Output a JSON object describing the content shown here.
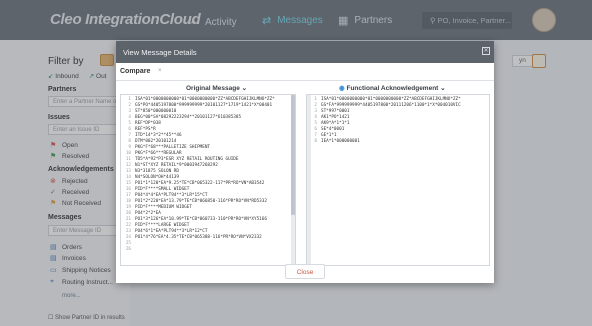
{
  "app": {
    "logo": "Cleo IntegrationCloud",
    "nav": [
      {
        "icon": "pulse-icon",
        "glyph": "〰",
        "label": "Activity"
      },
      {
        "icon": "arrows-exchange-icon",
        "glyph": "⇄",
        "label": "Messages",
        "active": true
      },
      {
        "icon": "partners-icon",
        "glyph": "▦",
        "label": "Partners"
      }
    ],
    "search_placeholder": "PO, Invoice, Partner..."
  },
  "filter": {
    "title": "Filter by",
    "inbound": "Inbound",
    "outbound": "Out",
    "sections": {
      "partners": "Partners",
      "partner_placeholder": "Enter a Partner Name or",
      "issues": "Issues",
      "issue_placeholder": "Enter an Issue ID",
      "open": "Open",
      "resolved": "Resolved",
      "acks": "Acknowledgements",
      "rejected": "Rejected",
      "received": "Received",
      "not_received": "Not Received",
      "messages": "Messages",
      "message_placeholder": "Enter Message ID",
      "orders": "Orders",
      "invoices": "Invoices",
      "shipping": "Shipping Notices",
      "routing": "Routing Instruct...",
      "more": "more...",
      "show_pid": "Show Partner ID in results"
    }
  },
  "right": {
    "select_value": "yn"
  },
  "modal": {
    "title": "View Message Details",
    "tab": "Compare",
    "left_title": "Original Message",
    "right_title": "Functional Acknowledgement",
    "close_label": "Close",
    "original_lines": [
      "ISA*01*0000000000*01*0000000000*ZZ*ABCDEFGHIJKLMNO*ZZ*",
      "GS*PO*4405197800*999999999*20101127*1719*1421*X*00401",
      "ST*850*000000010",
      "BEG*00*SA*08292223294**20101127*610385385",
      "REF*DP*038",
      "REF*PS*R",
      "ITD*14*3*2**45**46",
      "DTM*002*20101214",
      "PKG*F*68***PALLETIZE SHIPMENT",
      "PKG*F*66***REGULAR",
      "TD5*A*92*P3*ESR XYZ RETAIL ROUTING GUIDE",
      "N1*ST*XYZ RETAIL*9*0003947268292",
      "N3*31875 SOLON RD",
      "N4*SOLON*OH*44139",
      "PO1*1*120*EA*9.25*TE*CB*065322-117*PR*RO*VN*AB3542",
      "PID*F****SMALL WIDGET",
      "PO4*4*4*EA*PLT94**3*LR*15*CT",
      "PO1*2*220*EA*13.79*TE*CB*066850-116*PR*RO*VN*RD5332",
      "PID*F****MEDIUM WIDGET",
      "PO4*2*2*EA",
      "PO1*3*126*EA*10.99*TE*CB*060733-110*PR*RO*VN*XY5166",
      "PID*F****LARGE WIDGET",
      "PO4*6*1*EA*PLT94**3*LR*12*CT",
      "PO1*4*76*EA*4.35*TE*CB*065388-116*PR*RO*VN*VX2332",
      "",
      ""
    ],
    "ack_lines": [
      "ISA*01*0000000000*01*0000000000*ZZ*ABCDEFGHIJKLMNO*ZZ*",
      "GS*FA*999999999*4405197800*20111206*1100*1*X*004010VIC",
      "ST*997*0001",
      "AK1*PO*1421",
      "AK9*A*1*1*1",
      "SE*4*0001",
      "GE*1*1",
      "IEA*1*000000001"
    ]
  }
}
